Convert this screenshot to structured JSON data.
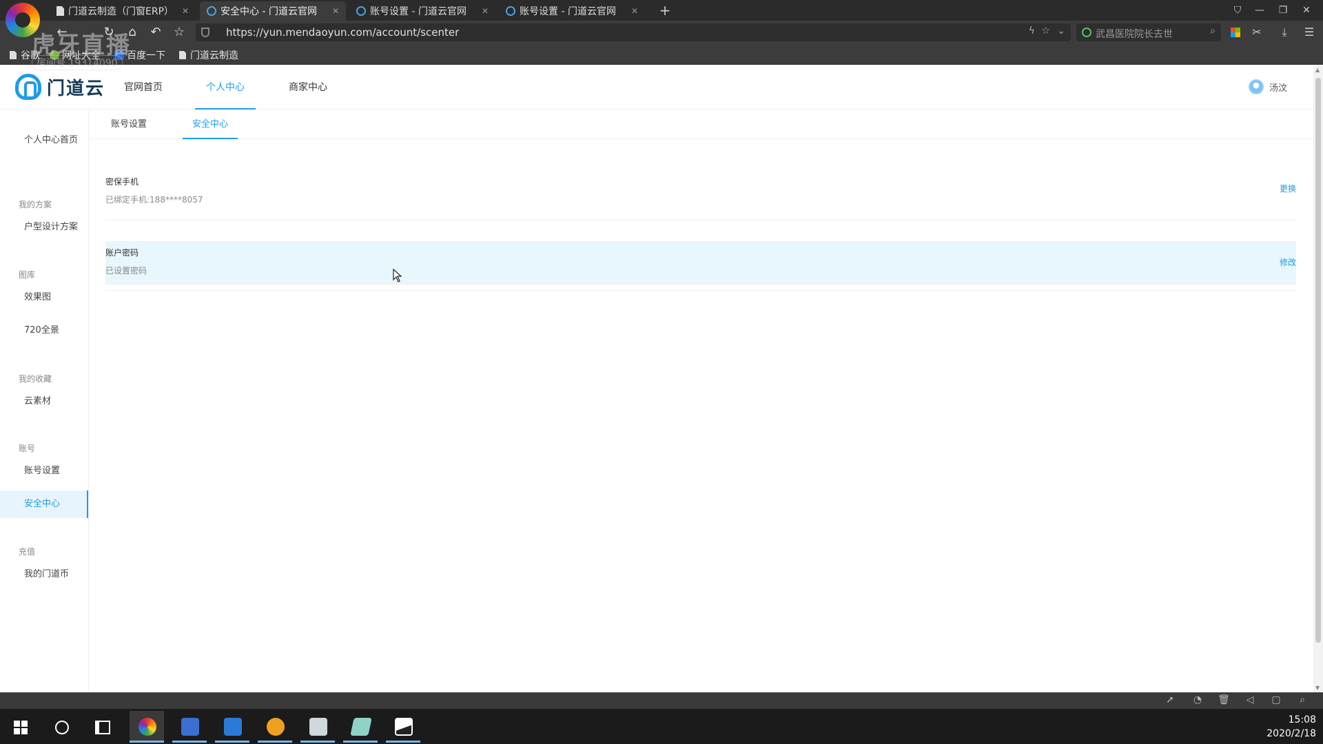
{
  "browser": {
    "tabs": [
      {
        "title": "门道云制造（门窗ERP）",
        "icon": "doc-icon",
        "active": false
      },
      {
        "title": "安全中心 - 门道云官网",
        "icon": "site-icon",
        "active": true
      },
      {
        "title": "账号设置 - 门道云官网",
        "icon": "site-icon",
        "active": false
      },
      {
        "title": "账号设置 - 门道云官网",
        "icon": "site-icon",
        "active": false
      }
    ],
    "new_tab": "+",
    "url": "https://yun.mendaoyun.com/account/scenter",
    "search_hint": "武昌医院院长去世",
    "bookmarks": [
      "谷歌",
      "网址大全",
      "百度一下",
      "门道云制造"
    ],
    "watermark": "虎牙直播",
    "watermark_id": "房间号 19314090"
  },
  "site": {
    "brand": "门道云",
    "nav": [
      "官网首页",
      "个人中心",
      "商家中心"
    ],
    "nav_active": 1,
    "user_name": "汤汶",
    "accent_color": "#1e9be8"
  },
  "sidebar": {
    "home": "个人中心首页",
    "groups": [
      {
        "label": "我的方案",
        "items": [
          "户型设计方案"
        ]
      },
      {
        "label": "图库",
        "items": [
          "效果图",
          "720全景"
        ]
      },
      {
        "label": "我的收藏",
        "items": [
          "云素材"
        ]
      },
      {
        "label": "账号",
        "items": [
          "账号设置",
          "安全中心"
        ]
      },
      {
        "label": "充值",
        "items": [
          "我的门道币"
        ]
      }
    ],
    "active_item": "安全中心"
  },
  "subtabs": [
    "账号设置",
    "安全中心"
  ],
  "subtab_active": 1,
  "security": [
    {
      "title": "密保手机",
      "desc": "已绑定手机:188****8057",
      "action": "更换"
    },
    {
      "title": "账户密码",
      "desc": "已设置密码",
      "action": "修改"
    }
  ],
  "taskbar": {
    "time": "15:08",
    "date": "2020/2/18"
  }
}
